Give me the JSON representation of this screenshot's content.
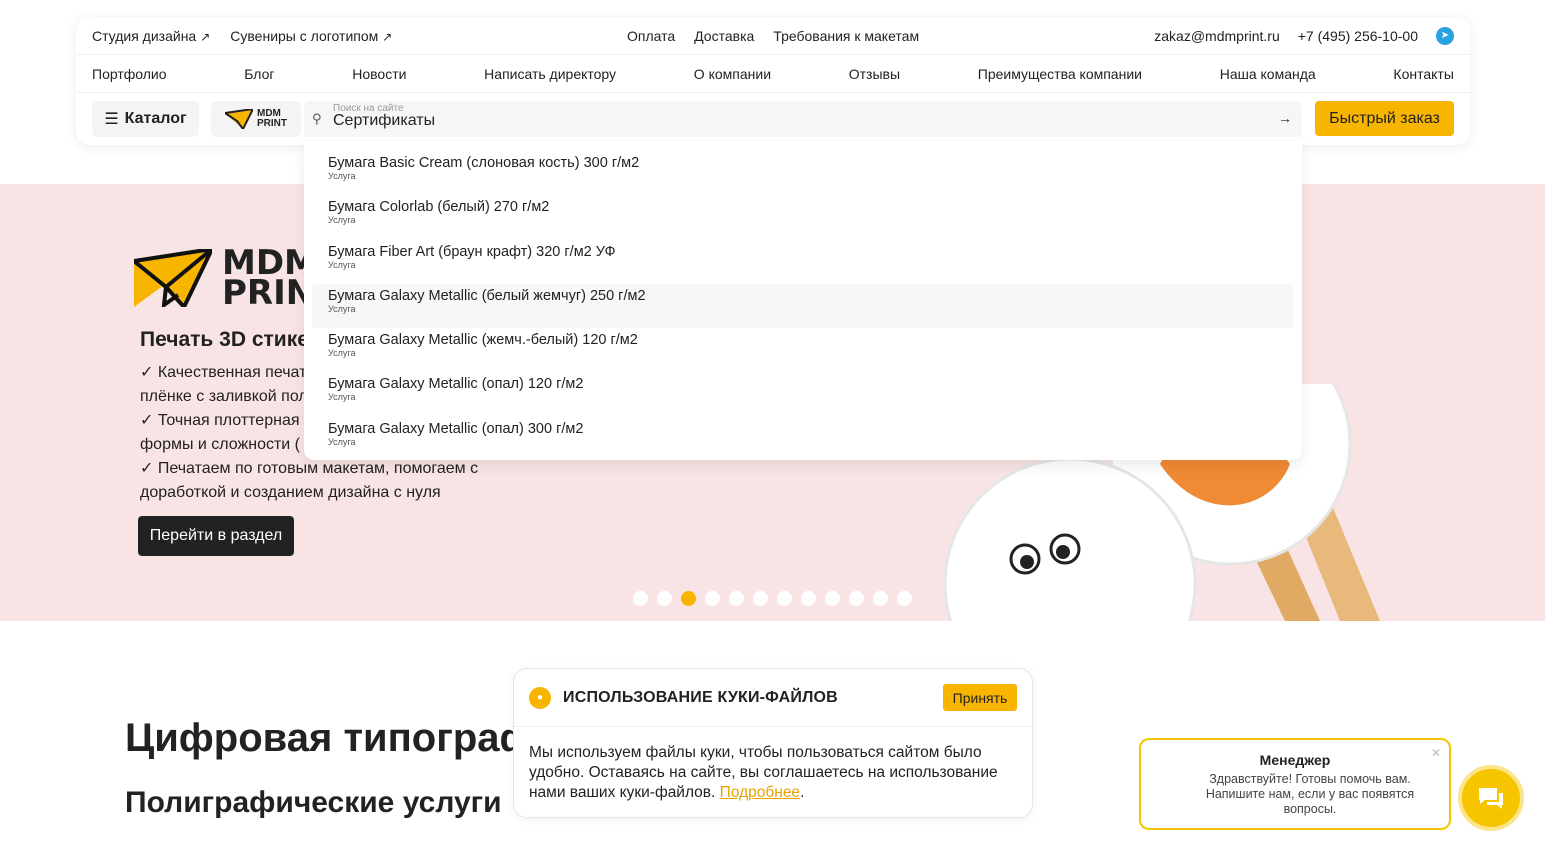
{
  "topbar": {
    "links_left": [
      "Студия дизайна",
      "Сувениры с логотипом"
    ],
    "links_center": [
      "Оплата",
      "Доставка",
      "Требования к макетам"
    ],
    "email": "zakaz@mdmprint.ru",
    "phone": "+7 (495) 256-10-00"
  },
  "nav": [
    "Портфолио",
    "Блог",
    "Новости",
    "Написать директору",
    "О компании",
    "Отзывы",
    "Преимущества компании",
    "Наша команда",
    "Контакты"
  ],
  "toolbar": {
    "catalog_label": "Каталог",
    "logo_line1": "MDM",
    "logo_line2": "PRINT",
    "search_placeholder": "Поиск на сайте",
    "search_value": "Сертификаты",
    "quick_order_label": "Быстрый заказ"
  },
  "search_results": [
    {
      "title": "Бумага Basic Cream (слоновая кость) 300 г/м2",
      "type": "Услуга"
    },
    {
      "title": "Бумага Colorlab (белый) 270 г/м2",
      "type": "Услуга"
    },
    {
      "title": "Бумага Fiber Art (браун крафт) 320 г/м2 УФ",
      "type": "Услуга"
    },
    {
      "title": "Бумага Galaxy Metallic (белый жемчуг) 250 г/м2",
      "type": "Услуга"
    },
    {
      "title": "Бумага Galaxy Metallic (жемч.-белый) 120 г/м2",
      "type": "Услуга"
    },
    {
      "title": "Бумага Galaxy Metallic (опал) 120 г/м2",
      "type": "Услуга"
    },
    {
      "title": "Бумага Galaxy Metallic (опал) 300 г/м2",
      "type": "Услуга"
    }
  ],
  "hero": {
    "logo_line1": "MDM",
    "logo_line2": "PRINT",
    "title": "Печать 3D стике",
    "lines": [
      "✓ Качественная печат",
      "плёнке с заливкой пол",
      "✓ Точная плоттерная",
      "формы и сложности (",
      "✓ Печатаем по готовым макетам, помогаем с",
      "доработкой и созданием дизайна с нуля"
    ],
    "button_label": "Перейти в раздел",
    "active_slide": 3,
    "slide_count": 12
  },
  "section": {
    "title": "Цифровая типограф",
    "subtitle": "Полиграфические услуги"
  },
  "cookie": {
    "title": "ИСПОЛЬЗОВАНИЕ КУКИ-ФАЙЛОВ",
    "accept_label": "Принять",
    "text": "Мы используем файлы куки, чтобы пользоваться сайтом было удобно. Оставаясь на сайте, вы соглашаетесь на использование нами ваших куки-файлов.",
    "link_label": "Подробнее"
  },
  "chat": {
    "name": "Менеджер",
    "message": "Здравствуйте! Готовы помочь вам. Напишите нам, если у вас появятся вопросы."
  },
  "colors": {
    "accent": "#f7b500",
    "hero_bg": "#f8e4e4",
    "dark": "#222222"
  }
}
